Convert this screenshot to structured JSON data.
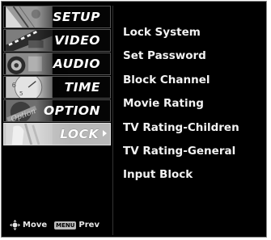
{
  "sidebar": {
    "items": [
      {
        "label": "SETUP"
      },
      {
        "label": "VIDEO"
      },
      {
        "label": "AUDIO"
      },
      {
        "label": "TIME"
      },
      {
        "label": "OPTION"
      },
      {
        "label": "LOCK"
      }
    ],
    "selected": "LOCK",
    "footer": {
      "move_label": "Move",
      "menu_key_label": "MENU",
      "prev_label": "Prev"
    }
  },
  "lock_menu": {
    "options": [
      "Lock System",
      "Set Password",
      "Block Channel",
      "Movie Rating",
      "TV Rating-Children",
      "TV Rating-General",
      "Input Block"
    ]
  },
  "colors": {
    "background": "#000000",
    "text": "#ffffff",
    "selected_item": "#c8c8c8"
  }
}
